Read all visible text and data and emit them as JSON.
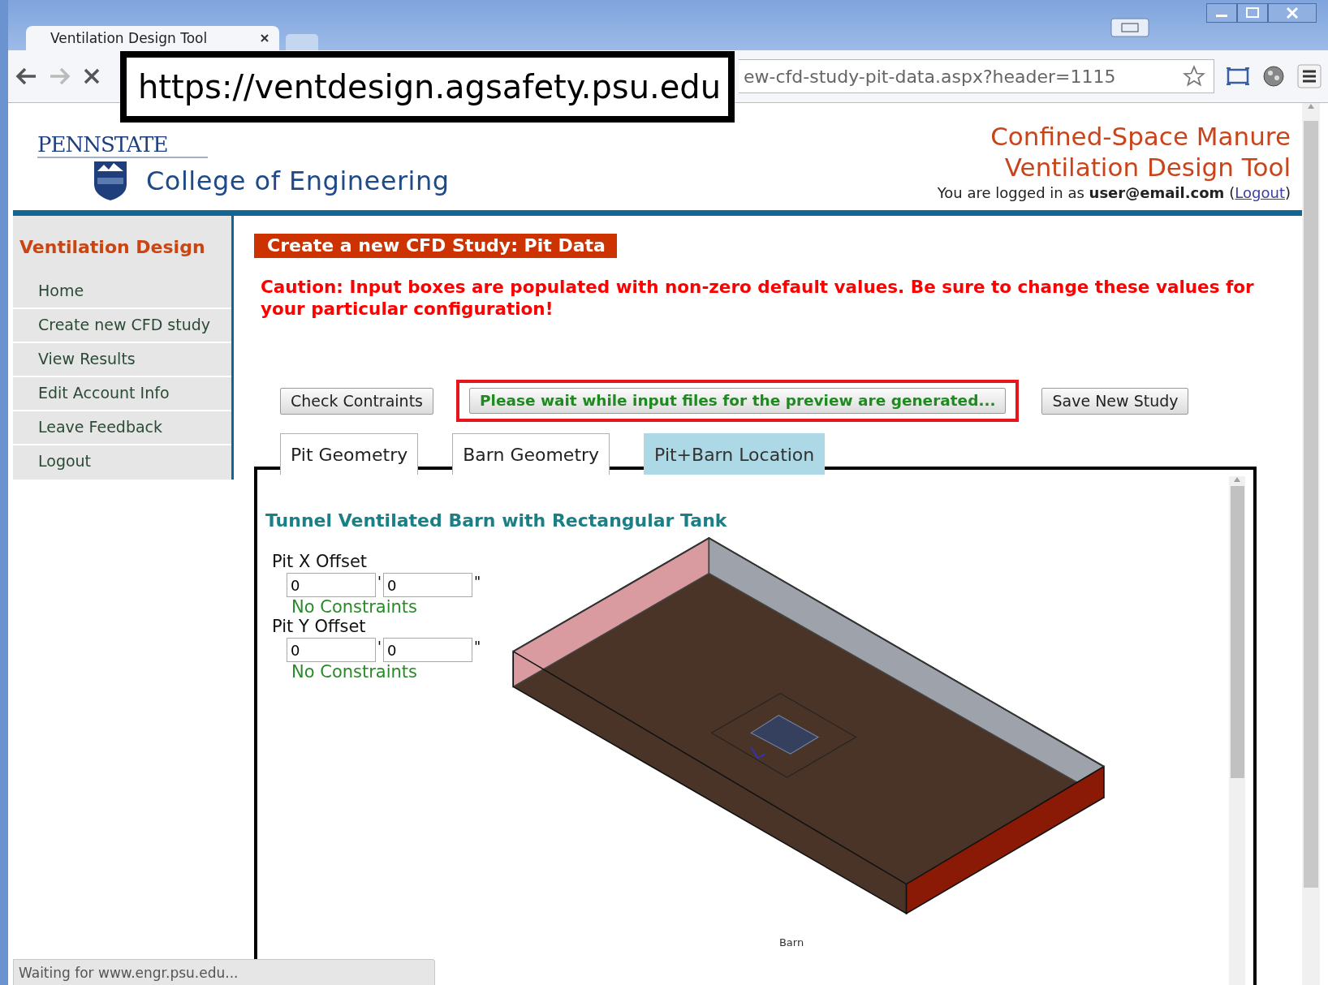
{
  "browser": {
    "tab_title": "Ventilation Design Tool",
    "address": "ew-cfd-study-pit-data.aspx?header=1115",
    "status": "Waiting for www.engr.psu.edu..."
  },
  "callout": {
    "url": "https://ventdesign.agsafety.psu.edu"
  },
  "header": {
    "logo_top": "PENNSTATE",
    "logo_college": "College of Engineering",
    "app_title_1": "Confined-Space Manure",
    "app_title_2": "Ventilation Design Tool",
    "login_text": "You are logged in as **user@email.com**",
    "open_paren": "(",
    "logout": "Logout",
    "close_paren": ")"
  },
  "sidebar": {
    "title": "Ventilation Design",
    "items": [
      {
        "label": "Home"
      },
      {
        "label": "Create new CFD study"
      },
      {
        "label": "View Results"
      },
      {
        "label": "Edit Account Info"
      },
      {
        "label": "Leave Feedback"
      },
      {
        "label": "Logout"
      }
    ]
  },
  "page": {
    "heading": "Create a new CFD Study: Pit Data",
    "caution": "Caution: Input boxes are populated with non-zero default values. Be sure to change these values for your particular configuration!",
    "buttons": [
      {
        "label": "Check Contraints",
        "kind": "normal"
      },
      {
        "label": "Please wait while input files for the preview are generated...",
        "kind": "status"
      },
      {
        "label": "Save New Study",
        "kind": "normal"
      }
    ],
    "tabs": [
      {
        "label": "Pit Geometry",
        "selected": false
      },
      {
        "label": "Barn Geometry",
        "selected": false
      },
      {
        "label": "Pit+Barn Location",
        "selected": true
      }
    ],
    "section_title": "Tunnel Ventilated Barn with Rectangular Tank",
    "fields": [
      {
        "label": "Pit X Offset",
        "feet": "0",
        "feet_mark": "'",
        "inches": "0",
        "inch_mark": "\"",
        "note": "No Constraints"
      },
      {
        "label": "Pit Y Offset",
        "feet": "0",
        "feet_mark": "'",
        "inches": "0",
        "inch_mark": "\"",
        "note": "No Constraints"
      }
    ],
    "figure_caption": "Barn"
  }
}
